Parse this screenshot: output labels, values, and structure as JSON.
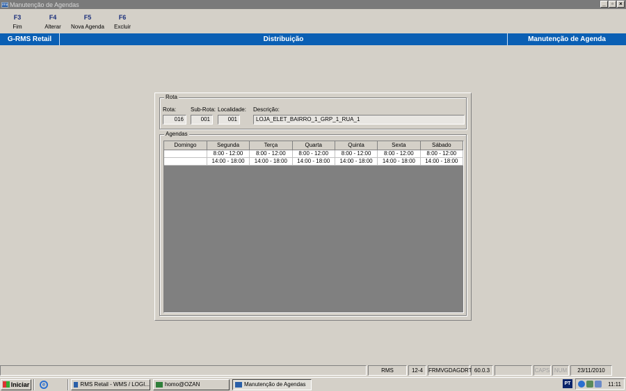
{
  "window": {
    "title": "Manutenção de Agendas"
  },
  "fkeys": [
    {
      "key": "F3",
      "label": "Fim"
    },
    {
      "key": "F4",
      "label": "Alterar"
    },
    {
      "key": "F5",
      "label": "Nova Agenda"
    },
    {
      "key": "F6",
      "label": "Excluir"
    }
  ],
  "header": {
    "left": "G-RMS Retail",
    "center": "Distribuição",
    "right": "Manutenção de Agenda"
  },
  "rota": {
    "group_title": "Rota",
    "rota_label": "Rota:",
    "rota_value": "016",
    "subrota_label": "Sub-Rota:",
    "subrota_value": "001",
    "localidade_label": "Localidade:",
    "localidade_value": "001",
    "descricao_label": "Descrição:",
    "descricao_value": "LOJA_ELET_BAIRRO_1_GRP_1_RUA_1"
  },
  "agendas": {
    "group_title": "Agendas",
    "columns": [
      "Domingo",
      "Segunda",
      "Terça",
      "Quarta",
      "Quinta",
      "Sexta",
      "Sábado"
    ],
    "rows": [
      [
        "",
        "8:00 - 12:00",
        "8:00 - 12:00",
        "8:00 - 12:00",
        "8:00 - 12:00",
        "8:00 - 12:00",
        "8:00 - 12:00"
      ],
      [
        "",
        "14:00 - 18:00",
        "14:00 - 18:00",
        "14:00 - 18:00",
        "14:00 - 18:00",
        "14:00 - 18:00",
        "14:00 - 18:00"
      ]
    ]
  },
  "statusbar": {
    "system": "RMS",
    "code": "12-4",
    "form": "FRMVGDAGDRT",
    "version": "60.0.3",
    "caps": "CAPS",
    "num": "NUM",
    "date": "23/11/2010"
  },
  "taskbar": {
    "start": "Iniciar",
    "tasks": [
      "RMS Retail - WMS / LOGI...",
      "homo@OZAN",
      "Manutenção de Agendas"
    ],
    "lang": "PT",
    "clock": "11:11"
  }
}
